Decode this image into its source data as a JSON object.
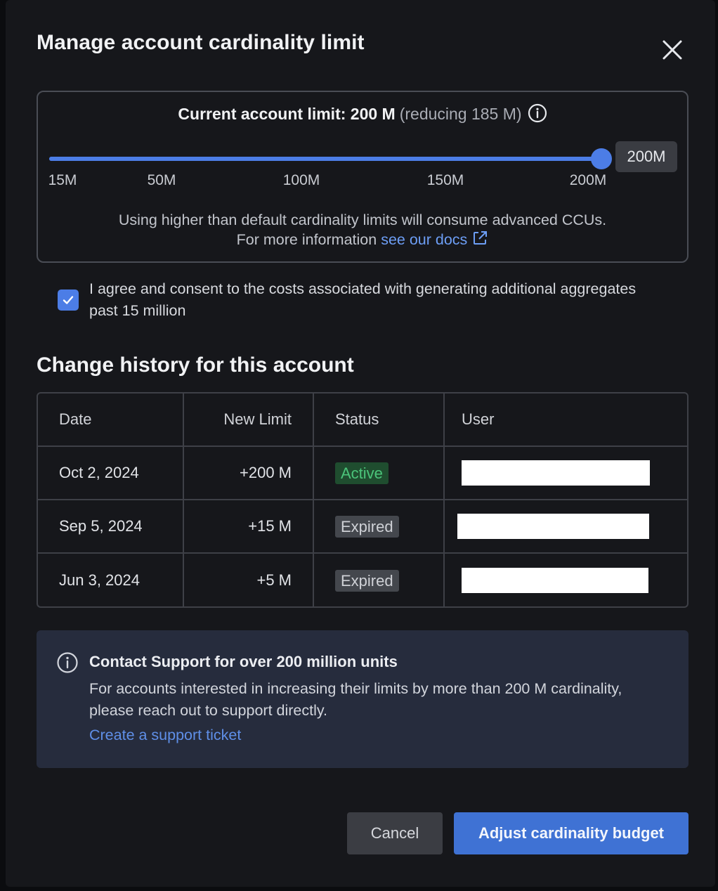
{
  "modal": {
    "title": "Manage account cardinality limit",
    "close_icon": "close-icon"
  },
  "limit_card": {
    "heading_label": "Current account limit: 200 M",
    "heading_sub": "(reducing 185 M)",
    "info_icon": "info-icon",
    "slider": {
      "value_tag": "200M",
      "fraction": 1.0,
      "ticks": [
        "15M",
        "50M",
        "100M",
        "150M",
        "200M"
      ]
    },
    "note_line1": "Using higher than default cardinality limits will consume advanced CCUs.",
    "note_line2_prefix": "For more information",
    "docs_link": "see our docs",
    "external_link_icon": "external-link-icon"
  },
  "consent": {
    "checked": true,
    "text": "I agree and consent to the costs associated with generating additional aggregates past 15 million"
  },
  "history": {
    "title": "Change history for this account",
    "columns": [
      "Date",
      "New Limit",
      "Status",
      "User"
    ],
    "rows": [
      {
        "date": "Oct 2, 2024",
        "limit": "+200 M",
        "status": "Active"
      },
      {
        "date": "Sep 5, 2024",
        "limit": "+15 M",
        "status": "Expired"
      },
      {
        "date": "Jun 3, 2024",
        "limit": "+5 M",
        "status": "Expired"
      }
    ]
  },
  "support": {
    "icon": "info-icon",
    "title": "Contact Support for over 200 million units",
    "body": "For accounts interested in increasing their limits by more than 200 M cardinality, please reach out to support directly.",
    "link": "Create a support ticket"
  },
  "footer": {
    "cancel_label": "Cancel",
    "primary_label": "Adjust cardinality budget"
  },
  "colors": {
    "accent": "#4c7de6",
    "active_badge_text": "#4bc47a",
    "active_badge_bg": "#1f4d2f",
    "link": "#6d9ef5",
    "support_bg": "#262c3d"
  }
}
